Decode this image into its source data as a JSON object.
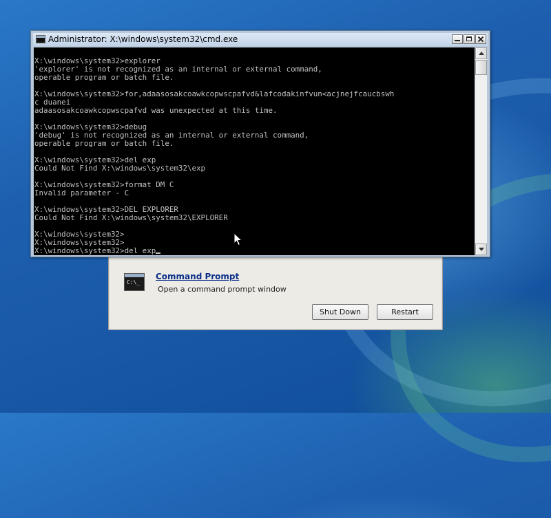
{
  "desktop": {
    "wallpaper_colors": [
      "#2a78c8",
      "#1a5aa8",
      "#5fbf7a"
    ]
  },
  "recovery_dialog": {
    "option": {
      "icon": "cmd-icon",
      "icon_text": "C:\\_",
      "title": "Command Prompt",
      "description": "Open a command prompt window"
    },
    "shutdown_label": "Shut Down",
    "restart_label": "Restart"
  },
  "cmd_window": {
    "title": "Administrator: X:\\windows\\system32\\cmd.exe",
    "icon": "cmd-icon",
    "controls": [
      "minimize",
      "maximize",
      "close"
    ],
    "lines": [
      "",
      "X:\\windows\\system32>explorer",
      "'explorer' is not recognized as an internal or external command,",
      "operable program or batch file.",
      "",
      "X:\\windows\\system32>for,adaasosakcoawkcopwscpafvd&lafcodakinfvun<acjnejfcaucbswh",
      "c duanei",
      "adaasosakcoawkcopwscpafvd was unexpected at this time.",
      "",
      "X:\\windows\\system32>debug",
      "'debug' is not recognized as an internal or external command,",
      "operable program or batch file.",
      "",
      "X:\\windows\\system32>del exp",
      "Could Not Find X:\\windows\\system32\\exp",
      "",
      "X:\\windows\\system32>format DM C",
      "Invalid parameter - C",
      "",
      "X:\\windows\\system32>DEL EXPLORER",
      "Could Not Find X:\\windows\\system32\\EXPLORER",
      "",
      "X:\\windows\\system32>",
      "X:\\windows\\system32>",
      "X:\\windows\\system32>del exp"
    ],
    "text_color": "#c0c0c0",
    "background_color": "#000000"
  }
}
